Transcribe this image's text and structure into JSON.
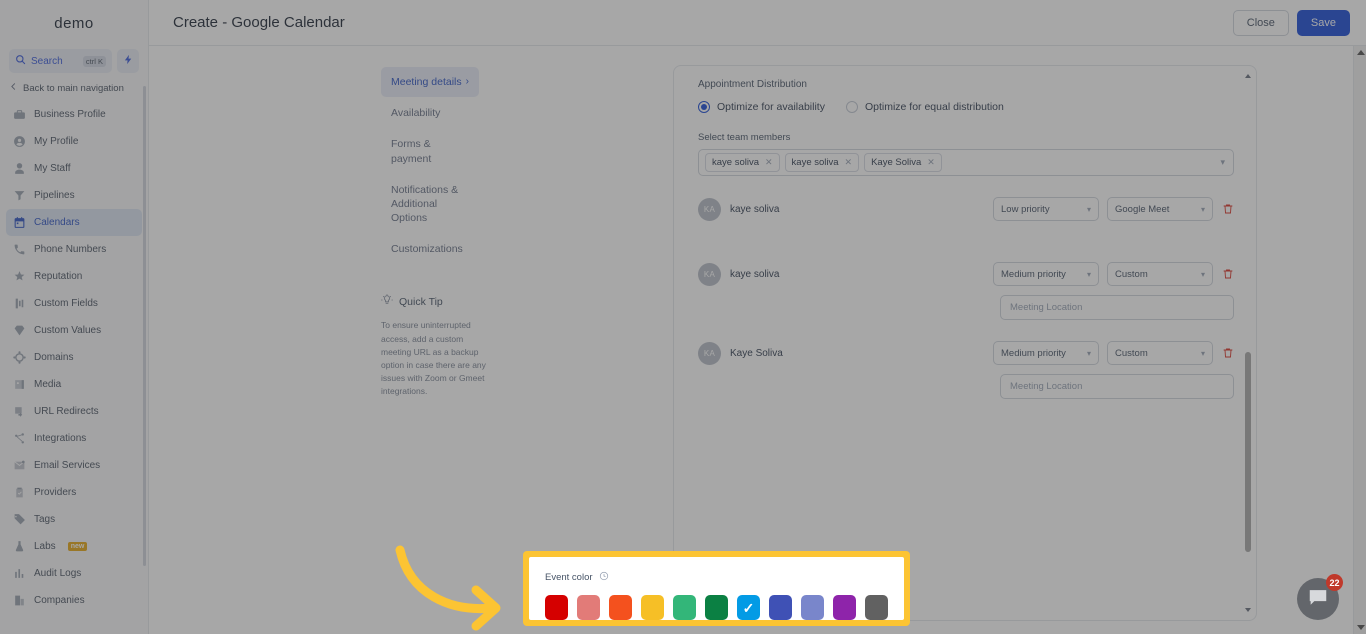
{
  "sidebar": {
    "brand": "demo",
    "search": {
      "placeholder": "Search",
      "shortcut": "ctrl K",
      "bolt_icon": "lightning-bolt-icon"
    },
    "back_label": "Back to main navigation",
    "items": [
      {
        "label": "Business Profile",
        "icon": "briefcase-icon",
        "active": false
      },
      {
        "label": "My Profile",
        "icon": "user-circle-icon",
        "active": false
      },
      {
        "label": "My Staff",
        "icon": "person-icon",
        "active": false
      },
      {
        "label": "Pipelines",
        "icon": "funnel-icon",
        "active": false
      },
      {
        "label": "Calendars",
        "icon": "calendar-icon",
        "active": true
      },
      {
        "label": "Phone Numbers",
        "icon": "phone-icon",
        "active": false
      },
      {
        "label": "Reputation",
        "icon": "star-icon",
        "active": false
      },
      {
        "label": "Custom Fields",
        "icon": "sliders-icon",
        "active": false
      },
      {
        "label": "Custom Values",
        "icon": "diamond-icon",
        "active": false
      },
      {
        "label": "Domains",
        "icon": "globe-icon",
        "active": false
      },
      {
        "label": "Media",
        "icon": "image-icon",
        "active": false
      },
      {
        "label": "URL Redirects",
        "icon": "link-icon",
        "active": false
      },
      {
        "label": "Integrations",
        "icon": "share-nodes-icon",
        "active": false
      },
      {
        "label": "Email Services",
        "icon": "envelope-icon",
        "active": false
      },
      {
        "label": "Providers",
        "icon": "clipboard-icon",
        "active": false
      },
      {
        "label": "Tags",
        "icon": "tag-icon",
        "active": false
      },
      {
        "label": "Labs",
        "icon": "flask-icon",
        "active": false,
        "badge": "new"
      },
      {
        "label": "Audit Logs",
        "icon": "bar-chart-icon",
        "active": false
      },
      {
        "label": "Companies",
        "icon": "building-icon",
        "active": false
      }
    ]
  },
  "topbar": {
    "title": "Create - Google Calendar",
    "close_label": "Close",
    "save_label": "Save"
  },
  "tabs": [
    {
      "label": "Meeting details",
      "active": true,
      "chevron": "›"
    },
    {
      "label": "Availability",
      "active": false
    },
    {
      "label": "Forms & payment",
      "active": false
    },
    {
      "label": "Notifications & Additional Options",
      "active": false
    },
    {
      "label": "Customizations",
      "active": false
    }
  ],
  "quick_tip": {
    "icon": "lightbulb-icon",
    "title": "Quick Tip",
    "body": "To ensure uninterrupted access, add a custom meeting URL as a backup option in case there are any issues with Zoom or Gmeet integrations."
  },
  "form": {
    "distribution_label": "Appointment Distribution",
    "radios": [
      {
        "label": "Optimize for availability",
        "selected": true
      },
      {
        "label": "Optimize for equal distribution",
        "selected": false
      }
    ],
    "team_members_label": "Select team members",
    "chips": [
      "kaye soliva",
      "kaye soliva",
      "Kaye Soliva"
    ],
    "members": [
      {
        "initials": "KA",
        "name": "kaye soliva",
        "priority": "Low priority",
        "meeting_type": "Google Meet",
        "has_location": false,
        "delete_icon": "trash-icon"
      },
      {
        "initials": "KA",
        "name": "kaye soliva",
        "priority": "Medium priority",
        "meeting_type": "Custom",
        "has_location": true,
        "location_placeholder": "Meeting Location",
        "delete_icon": "trash-icon"
      },
      {
        "initials": "KA",
        "name": "Kaye Soliva",
        "priority": "Medium priority",
        "meeting_type": "Custom",
        "has_location": true,
        "location_placeholder": "Meeting Location",
        "delete_icon": "trash-icon"
      }
    ]
  },
  "event_color": {
    "label": "Event color",
    "info_icon": "info-circle-icon",
    "highlight_color": "#fcc433",
    "selected_index": 6,
    "swatches": [
      {
        "name": "red",
        "hex": "#d50000"
      },
      {
        "name": "salmon",
        "hex": "#e27b78"
      },
      {
        "name": "orange",
        "hex": "#f4511e"
      },
      {
        "name": "yellow",
        "hex": "#f6bf26"
      },
      {
        "name": "mint-green",
        "hex": "#33b679"
      },
      {
        "name": "dark-green",
        "hex": "#0b8043"
      },
      {
        "name": "light-blue",
        "hex": "#039be5"
      },
      {
        "name": "indigo",
        "hex": "#3f51b5"
      },
      {
        "name": "periwinkle",
        "hex": "#7986cb"
      },
      {
        "name": "purple",
        "hex": "#8e24aa"
      },
      {
        "name": "graphite",
        "hex": "#616161"
      }
    ]
  },
  "annotation": {
    "arrow_color": "#fcc433",
    "arrow_icon": "curved-arrow-right-icon"
  },
  "chat_widget": {
    "icon": "chat-bubble-icon",
    "badge_count": "22"
  }
}
